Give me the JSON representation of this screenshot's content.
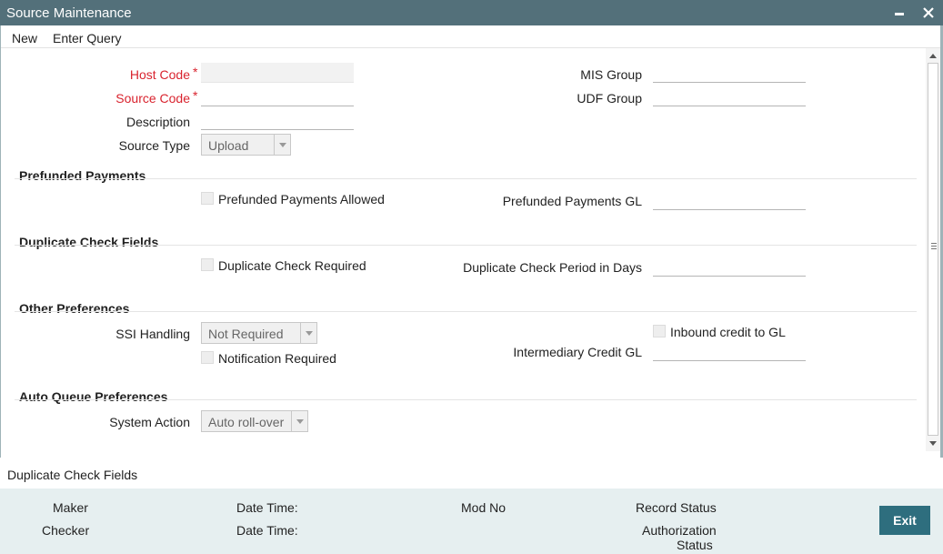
{
  "window": {
    "title": "Source Maintenance",
    "minimize_glyph": "▬",
    "close_glyph": "✕"
  },
  "menu": {
    "new_label": "New",
    "enter_query_label": "Enter Query"
  },
  "form": {
    "host_code": {
      "label": "Host Code",
      "required": "*",
      "value": ""
    },
    "source_code": {
      "label": "Source Code",
      "required": "*",
      "value": ""
    },
    "description": {
      "label": "Description",
      "value": ""
    },
    "source_type": {
      "label": "Source Type",
      "value": "Upload"
    },
    "mis_group": {
      "label": "MIS Group",
      "value": ""
    },
    "udf_group": {
      "label": "UDF Group",
      "value": ""
    }
  },
  "prefunded": {
    "heading": "Prefunded Payments",
    "allowed_label": "Prefunded Payments Allowed",
    "gl_label": "Prefunded Payments GL",
    "gl_value": ""
  },
  "duplicate": {
    "heading": "Duplicate Check Fields",
    "required_label": "Duplicate Check Required",
    "period_label": "Duplicate Check Period in Days",
    "period_value": ""
  },
  "other": {
    "heading": "Other Preferences",
    "ssi_label": "SSI Handling",
    "ssi_value": "Not Required",
    "notification_label": "Notification Required",
    "inbound_label": "Inbound credit to GL",
    "intermediary_label": "Intermediary Credit GL",
    "intermediary_value": ""
  },
  "auto_queue": {
    "heading": "Auto Queue Preferences",
    "system_action_label": "System Action",
    "system_action_value": "Auto roll-over"
  },
  "footer_tab": {
    "label": "Duplicate Check Fields"
  },
  "audit": {
    "maker": "Maker",
    "checker": "Checker",
    "date_time_1": "Date Time:",
    "date_time_2": "Date Time:",
    "mod_no": "Mod No",
    "record_status": "Record Status",
    "authorization": "Authorization",
    "status": "Status",
    "exit_label": "Exit"
  }
}
